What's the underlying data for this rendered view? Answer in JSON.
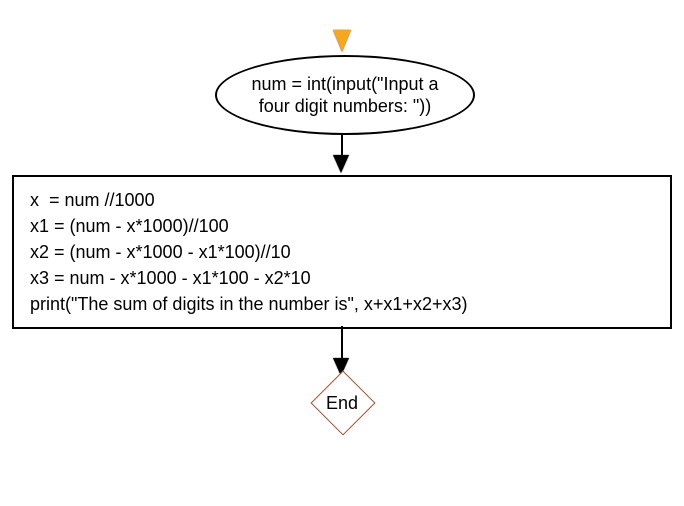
{
  "flow": {
    "input_ellipse": "num = int(input(\"Input a\nfour digit numbers: \"))",
    "process_box": "x  = num //1000\nx1 = (num - x*1000)//100\nx2 = (num - x*1000 - x1*100)//10\nx3 = num - x*1000 - x1*100 - x2*10\nprint(\"The sum of digits in the number is\", x+x1+x2+x3)",
    "end_label": "End"
  }
}
